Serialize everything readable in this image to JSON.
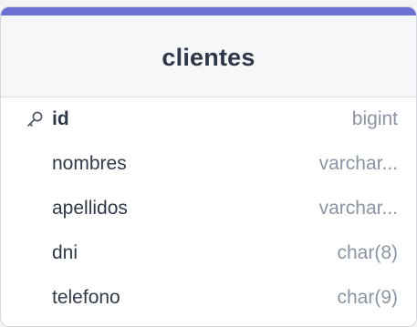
{
  "table": {
    "name": "clientes",
    "accent_color": "#6b71d2",
    "columns": [
      {
        "name": "id",
        "type": "bigint",
        "primary_key": true,
        "icon": "key-icon"
      },
      {
        "name": "nombres",
        "type": "varchar...",
        "primary_key": false
      },
      {
        "name": "apellidos",
        "type": "varchar...",
        "primary_key": false
      },
      {
        "name": "dni",
        "type": "char(8)",
        "primary_key": false
      },
      {
        "name": "telefono",
        "type": "char(9)",
        "primary_key": false
      }
    ]
  }
}
